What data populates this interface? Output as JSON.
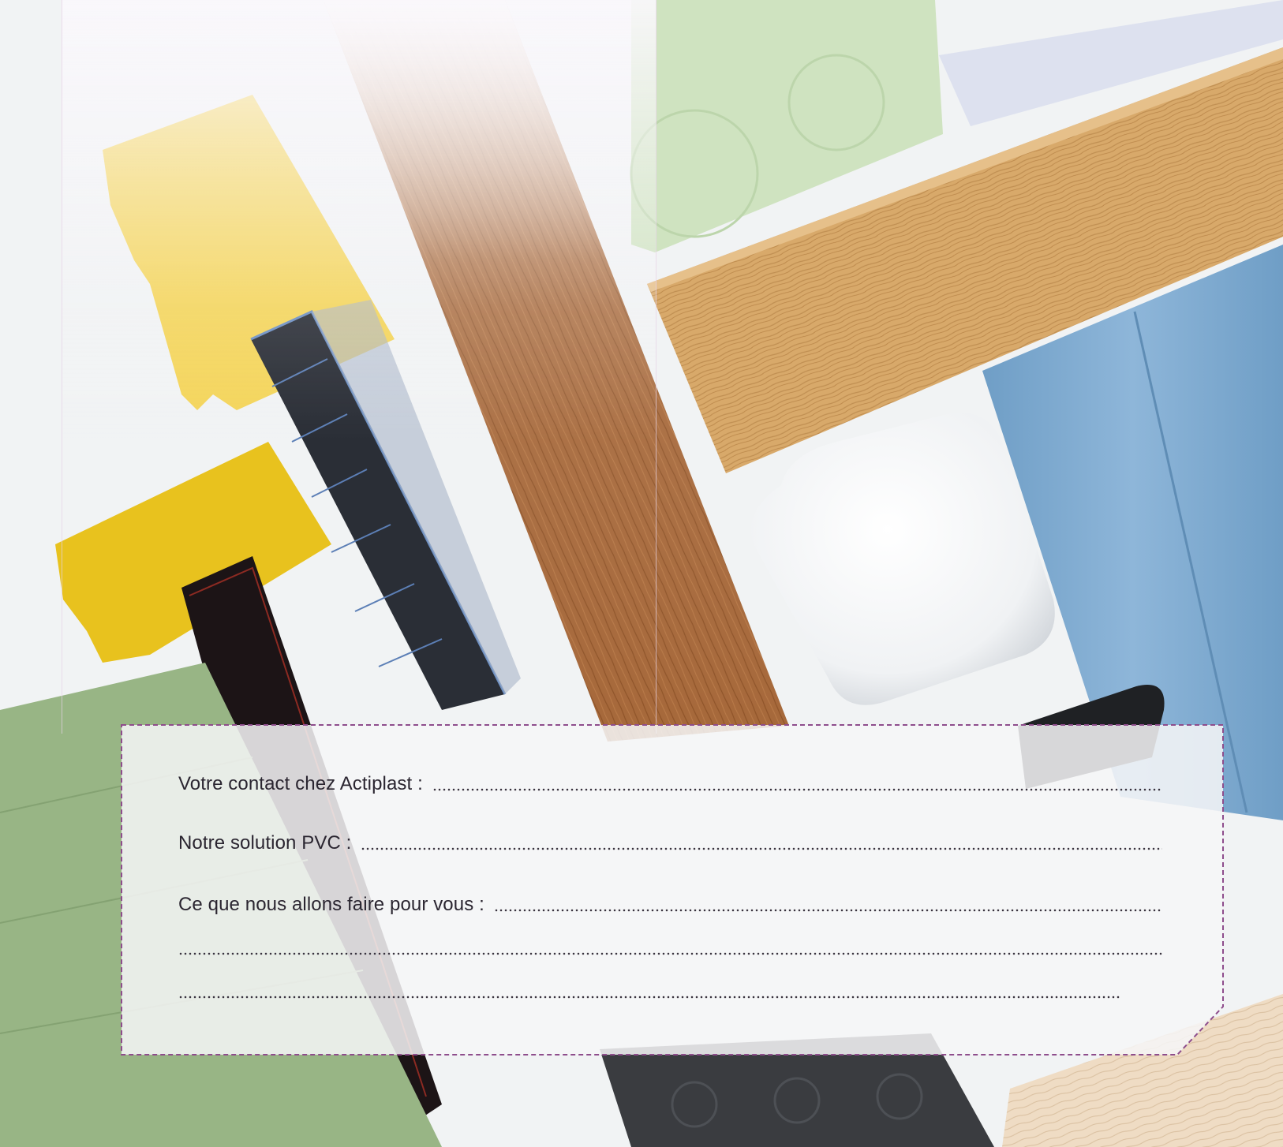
{
  "colors": {
    "frame_border": "#8e4d8c",
    "text": "#2a2530",
    "card_fill": "#f6f6f7"
  },
  "background": {
    "description_icon": "pvc-products-photo"
  },
  "form": {
    "contact_label": "Votre contact chez Actiplast :",
    "solution_label": "Notre solution PVC :",
    "actions_label": "Ce que nous allons faire pour vous :"
  }
}
